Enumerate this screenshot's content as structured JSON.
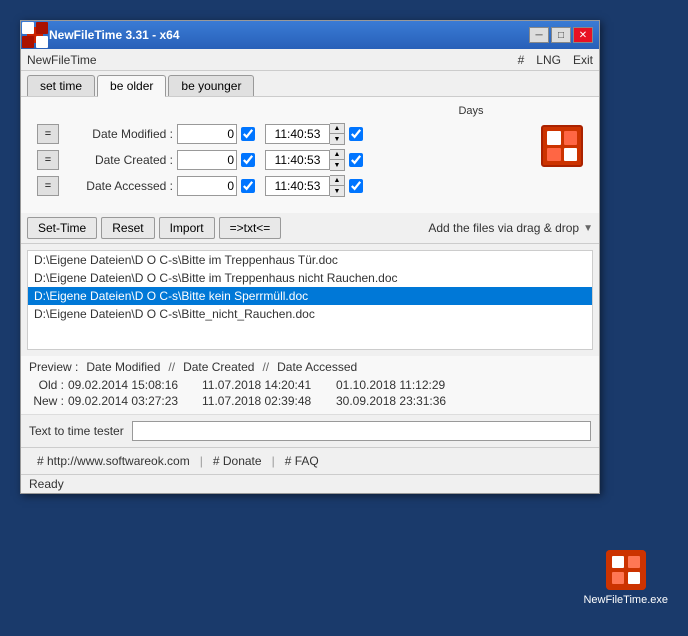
{
  "window": {
    "title": "NewFileTime 3.31 - x64",
    "icon_label": "NFT",
    "min_btn": "─",
    "max_btn": "□",
    "close_btn": "✕"
  },
  "menu": {
    "left": "NewFileTime",
    "hash": "#",
    "lng": "LNG",
    "exit": "Exit"
  },
  "tabs": [
    {
      "label": "set time",
      "active": false
    },
    {
      "label": "be older",
      "active": true
    },
    {
      "label": "be younger",
      "active": false
    }
  ],
  "days_header": "Days",
  "rows": [
    {
      "eq": "=",
      "label": "Date Modified :",
      "days_value": "0",
      "checked1": true,
      "time": "11:40:53",
      "checked2": true
    },
    {
      "eq": "=",
      "label": "Date Created :",
      "days_value": "0",
      "checked1": true,
      "time": "11:40:53",
      "checked2": true
    },
    {
      "eq": "=",
      "label": "Date Accessed :",
      "days_value": "0",
      "checked1": true,
      "time": "11:40:53",
      "checked2": true
    }
  ],
  "toolbar": {
    "set_time": "Set-Time",
    "reset": "Reset",
    "import": "Import",
    "convert": "=>txt<=",
    "drag_drop": "Add the files via drag & drop"
  },
  "files": [
    {
      "path": "D:\\Eigene Dateien\\D O C-s\\Bitte im Treppenhaus Tür.doc",
      "selected": false
    },
    {
      "path": "D:\\Eigene Dateien\\D O C-s\\Bitte im Treppenhaus nicht Rauchen.doc",
      "selected": false
    },
    {
      "path": "D:\\Eigene Dateien\\D O C-s\\Bitte kein Sperrmüll.doc",
      "selected": true
    },
    {
      "path": "D:\\Eigene Dateien\\D O C-s\\Bitte_nicht_Rauchen.doc",
      "selected": false
    }
  ],
  "preview": {
    "label": "Preview :",
    "date_modified": "Date Modified",
    "divider1": "//",
    "date_created": "Date Created",
    "divider2": "//",
    "date_accessed": "Date Accessed",
    "old_label": "Old :",
    "old_modified": "09.02.2014 15:08:16",
    "old_created": "11.07.2018 14:20:41",
    "old_accessed": "01.10.2018 11:12:29",
    "new_label": "New :",
    "new_modified": "09.02.2014 03:27:23",
    "new_created": "11.07.2018 02:39:48",
    "new_accessed": "30.09.2018 23:31:36"
  },
  "text_tester": {
    "label": "Text to time tester",
    "placeholder": ""
  },
  "footer": {
    "link1": "# http://www.softwareok.com",
    "link2": "# Donate",
    "link3": "# FAQ"
  },
  "status": "Ready",
  "exe": {
    "label": "NewFileTime.exe"
  }
}
